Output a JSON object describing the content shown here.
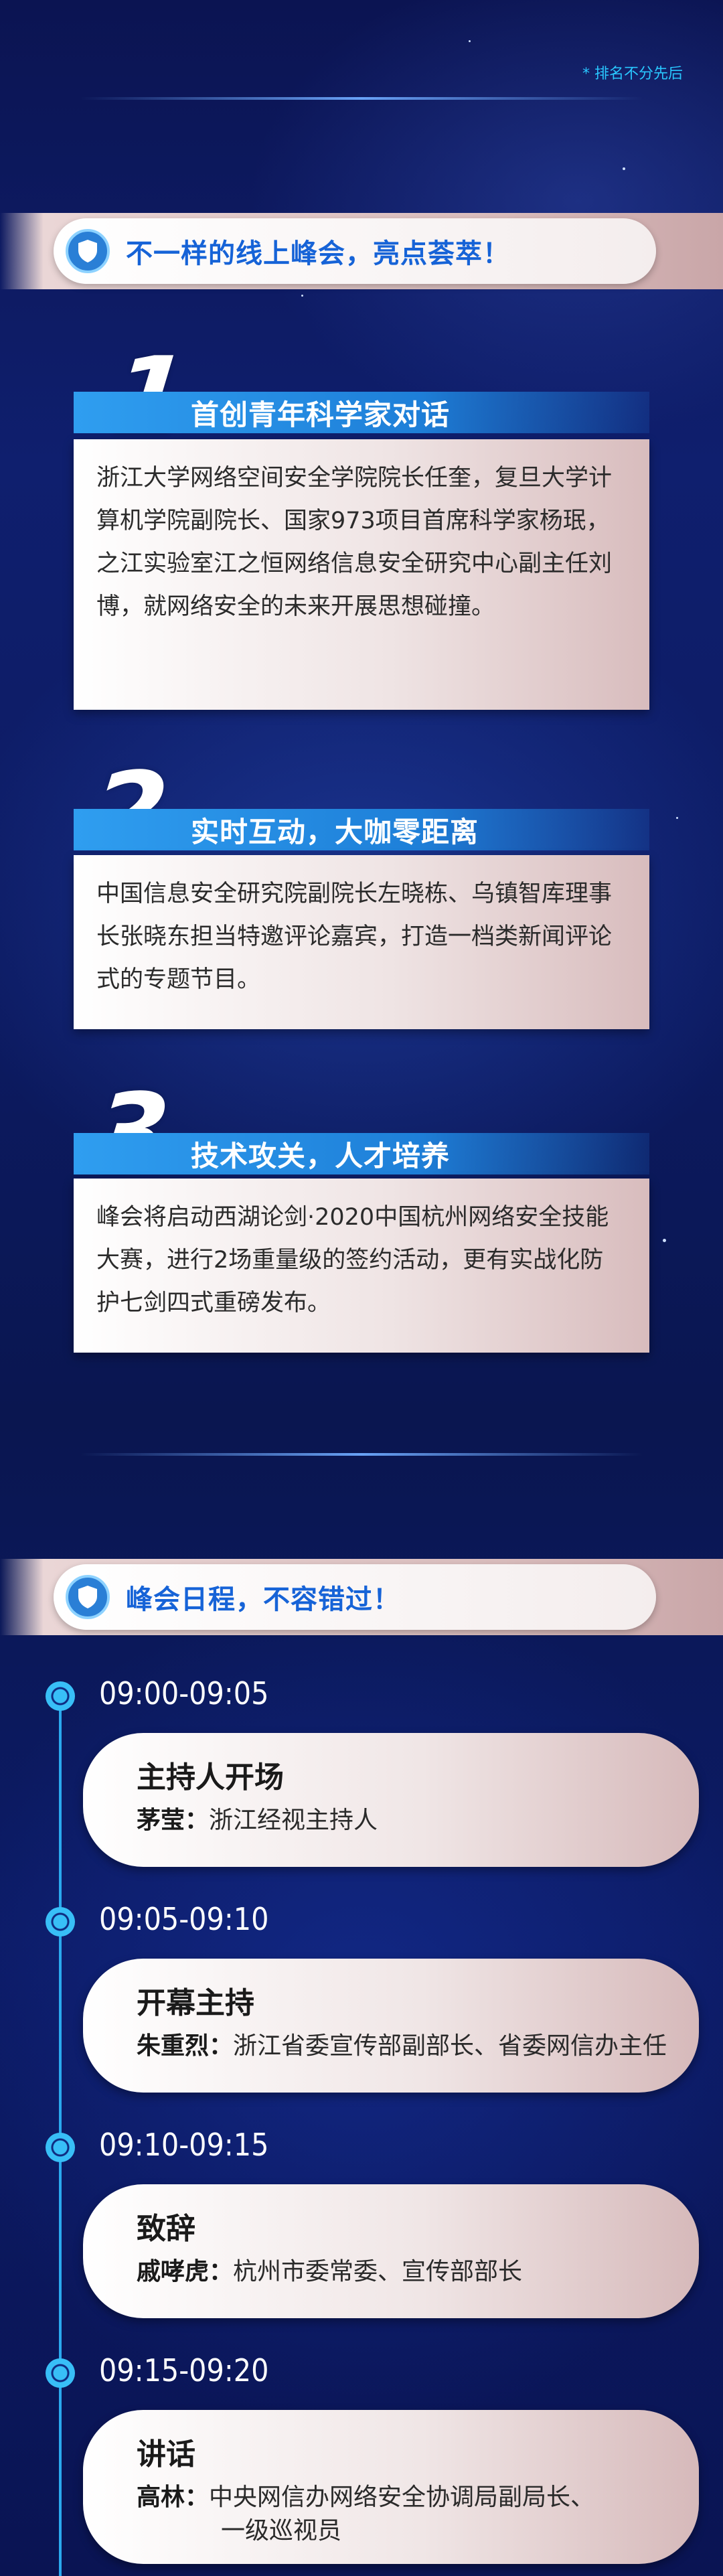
{
  "note": "* 排名不分先后",
  "section1": {
    "title": "不一样的线上峰会，亮点荟萃！",
    "icon": "shield-icon"
  },
  "highlights": [
    {
      "number": "1",
      "title": "首创青年科学家对话",
      "text": "浙江大学网络空间安全学院院长任奎，复旦大学计算机学院副院长、国家973项目首席科学家杨珉，之江实验室江之恒网络信息安全研究中心副主任刘博，就网络安全的未来开展思想碰撞。"
    },
    {
      "number": "2",
      "title": "实时互动，大咖零距离",
      "text": "中国信息安全研究院副院长左晓栋、乌镇智库理事长张晓东担当特邀评论嘉宾，打造一档类新闻评论式的专题节目。"
    },
    {
      "number": "3",
      "title": "技术攻关，人才培养",
      "text": "峰会将启动西湖论剑·2020中国杭州网络安全技能大赛，进行2场重量级的签约活动，更有实战化防护七剑四式重磅发布。"
    }
  ],
  "section2": {
    "title": "峰会日程，不容错过！",
    "icon": "shield-icon"
  },
  "schedule": [
    {
      "time": "09:00-09:05",
      "title": "主持人开场",
      "name": "茅莹：",
      "role": "浙江经视主持人",
      "role2": ""
    },
    {
      "time": "09:05-09:10",
      "title": "开幕主持",
      "name": "朱重烈：",
      "role": "浙江省委宣传部副部长、省委网信办主任",
      "role2": ""
    },
    {
      "time": "09:10-09:15",
      "title": "致辞",
      "name": "戚哮虎：",
      "role": "杭州市委常委、宣传部部长",
      "role2": ""
    },
    {
      "time": "09:15-09:20",
      "title": "讲话",
      "name": "高林：",
      "role": "中央网信办网络安全协调局副局长、",
      "role2": "一级巡视员"
    }
  ],
  "colors": {
    "accent_blue": "#1663d7",
    "bar_blue": "#2f9ef0",
    "timeline_cyan": "#2aa9ee",
    "note_cyan": "#29c7ff",
    "background_navy": "#0c1a60"
  }
}
